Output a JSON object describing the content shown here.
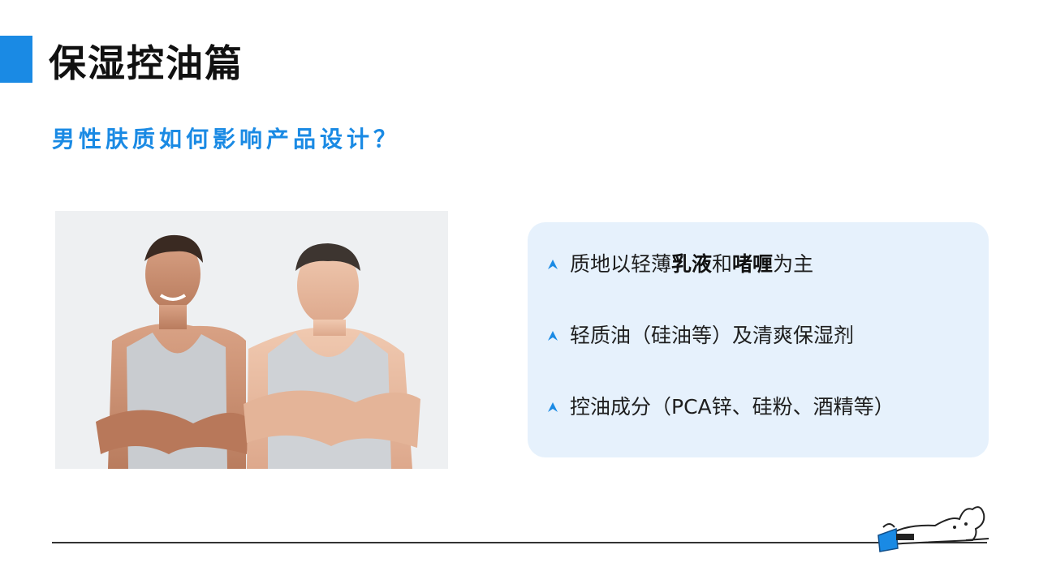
{
  "slide": {
    "title": "保湿控油篇",
    "subtitle": "男性肤质如何影响产品设计？",
    "accent_color": "#1a8ae4",
    "panel_color": "#e6f1fc",
    "photo_description_icon": "two-men-photo",
    "bullet_icon": "chevron-up-icon",
    "bullets": [
      {
        "parts": [
          {
            "text": "质地以轻薄",
            "bold": false
          },
          {
            "text": "乳液",
            "bold": true
          },
          {
            "text": "和",
            "bold": false
          },
          {
            "text": "啫喱",
            "bold": true
          },
          {
            "text": "为主",
            "bold": false
          }
        ]
      },
      {
        "parts": [
          {
            "text": "轻质油（硅油等）及清爽保湿剂",
            "bold": false
          }
        ]
      },
      {
        "parts": [
          {
            "text": "控油成分（PCA锌、硅粉、酒精等）",
            "bold": false
          }
        ]
      }
    ],
    "footer_mascot_icon": "reading-mascot-icon"
  }
}
